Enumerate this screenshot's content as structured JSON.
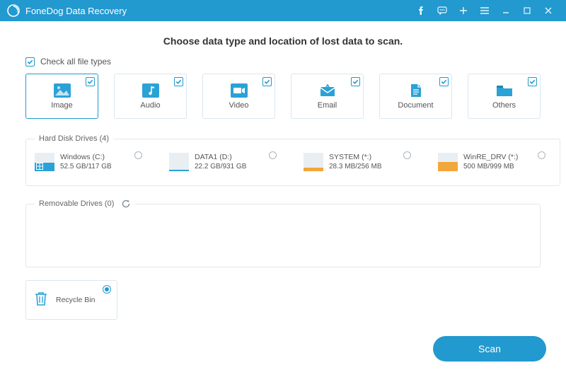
{
  "app": {
    "title": "FoneDog Data Recovery"
  },
  "headline": "Choose data type and location of lost data to scan.",
  "checkAllLabel": "Check all file types",
  "types": [
    {
      "label": "Image"
    },
    {
      "label": "Audio"
    },
    {
      "label": "Video"
    },
    {
      "label": "Email"
    },
    {
      "label": "Document"
    },
    {
      "label": "Others"
    }
  ],
  "hdd": {
    "legend": "Hard Disk Drives (4)",
    "items": [
      {
        "name": "Windows (C:)",
        "size": "52.5 GB/117 GB",
        "color": "#2aa2d6",
        "fill": 45,
        "showOs": true
      },
      {
        "name": "DATA1 (D:)",
        "size": "22.2 GB/931 GB",
        "color": "#2aa2d6",
        "fill": 8,
        "showOs": false
      },
      {
        "name": "SYSTEM (*:)",
        "size": "28.3 MB/256 MB",
        "color": "#f3a63a",
        "fill": 18,
        "showOs": false
      },
      {
        "name": "WinRE_DRV (*:)",
        "size": "500 MB/999 MB",
        "color": "#f3a63a",
        "fill": 50,
        "showOs": false
      }
    ]
  },
  "removable": {
    "legend": "Removable Drives (0)"
  },
  "recycle": {
    "label": "Recycle Bin"
  },
  "scanLabel": "Scan"
}
